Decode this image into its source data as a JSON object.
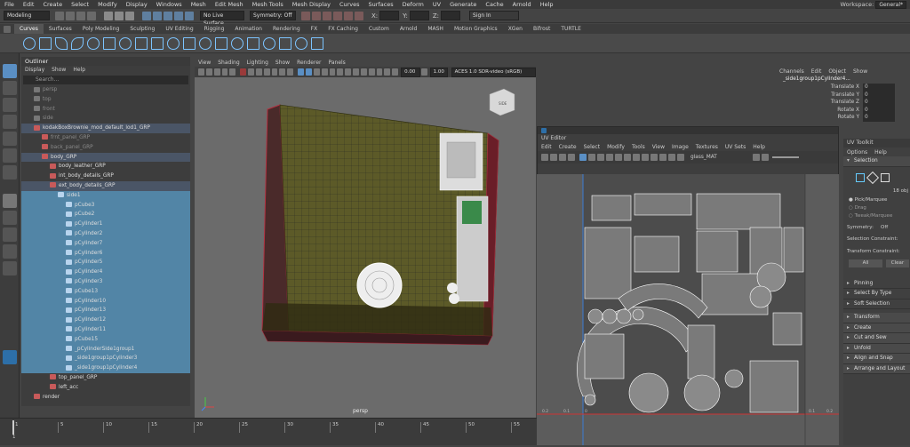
{
  "menubar": {
    "items": [
      "File",
      "Edit",
      "Create",
      "Select",
      "Modify",
      "Display",
      "Windows",
      "Mesh",
      "Edit Mesh",
      "Mesh Tools",
      "Mesh Display",
      "Curves",
      "Surfaces",
      "Deform",
      "UV",
      "Generate",
      "Cache",
      "Arnold",
      "Help"
    ],
    "workspace_label": "Workspace:",
    "workspace_value": "General*"
  },
  "status": {
    "mode": "Modeling",
    "live_surface": "No Live Surface",
    "symmetry": "Symmetry: Off",
    "x_label": "X:",
    "y_label": "Y:",
    "z_label": "Z:",
    "sign_in": "Sign In"
  },
  "shelf_tabs": [
    "Curves",
    "Surfaces",
    "Poly Modeling",
    "Sculpting",
    "UV Editing",
    "Rigging",
    "Animation",
    "Rendering",
    "FX",
    "FX Caching",
    "Custom",
    "Arnold",
    "MASH",
    "Motion Graphics",
    "XGen",
    "Bifrost",
    "TURTLE"
  ],
  "shelf_active": "Curves",
  "outliner": {
    "title": "Outliner",
    "menu": [
      "Display",
      "Show",
      "Help"
    ],
    "search_placeholder": "Search...",
    "items": [
      {
        "label": "persp",
        "indent": 0,
        "state": "dim"
      },
      {
        "label": "top",
        "indent": 0,
        "state": "dim"
      },
      {
        "label": "front",
        "indent": 0,
        "state": "dim"
      },
      {
        "label": "side",
        "indent": 0,
        "state": "dim"
      },
      {
        "label": "kodakBoxBrownie_mod_default_lod1_GRP",
        "indent": 0,
        "state": "hl"
      },
      {
        "label": "frnt_panel_GRP",
        "indent": 1,
        "state": "dim"
      },
      {
        "label": "back_panel_GRP",
        "indent": 1,
        "state": "dim"
      },
      {
        "label": "body_GRP",
        "indent": 1,
        "state": "hl"
      },
      {
        "label": "body_leather_GRP",
        "indent": 2,
        "state": ""
      },
      {
        "label": "int_body_details_GRP",
        "indent": 2,
        "state": ""
      },
      {
        "label": "ext_body_details_GRP",
        "indent": 2,
        "state": "hl"
      },
      {
        "label": "side1",
        "indent": 3,
        "state": "sel"
      },
      {
        "label": "pCube3",
        "indent": 4,
        "state": "sel"
      },
      {
        "label": "pCube2",
        "indent": 4,
        "state": "sel"
      },
      {
        "label": "pCylinder1",
        "indent": 4,
        "state": "sel"
      },
      {
        "label": "pCylinder2",
        "indent": 4,
        "state": "sel"
      },
      {
        "label": "pCylinder7",
        "indent": 4,
        "state": "sel"
      },
      {
        "label": "pCylinder6",
        "indent": 4,
        "state": "sel"
      },
      {
        "label": "pCylinder5",
        "indent": 4,
        "state": "sel"
      },
      {
        "label": "pCylinder4",
        "indent": 4,
        "state": "sel"
      },
      {
        "label": "pCylinder3",
        "indent": 4,
        "state": "sel"
      },
      {
        "label": "pCube13",
        "indent": 4,
        "state": "sel"
      },
      {
        "label": "pCylinder10",
        "indent": 4,
        "state": "sel"
      },
      {
        "label": "pCylinder13",
        "indent": 4,
        "state": "sel"
      },
      {
        "label": "pCylinder12",
        "indent": 4,
        "state": "sel"
      },
      {
        "label": "pCylinder11",
        "indent": 4,
        "state": "sel"
      },
      {
        "label": "pCube15",
        "indent": 4,
        "state": "sel"
      },
      {
        "label": "_pCylinderSide1group1",
        "indent": 4,
        "state": "sel"
      },
      {
        "label": "_side1group1pCylinder3",
        "indent": 4,
        "state": "sel"
      },
      {
        "label": "_side1group1pCylinder4",
        "indent": 4,
        "state": "sel"
      },
      {
        "label": "top_panel_GRP",
        "indent": 2,
        "state": ""
      },
      {
        "label": "left_acc",
        "indent": 2,
        "state": ""
      },
      {
        "label": "render",
        "indent": 0,
        "state": ""
      }
    ]
  },
  "viewport": {
    "menu": [
      "View",
      "Shading",
      "Lighting",
      "Show",
      "Renderer",
      "Panels"
    ],
    "field1": "0.00",
    "field2": "1.00",
    "colorspace": "ACES 1.0 SDR-video (sRGB)",
    "camera_label": "persp",
    "cube_label": "SIDE"
  },
  "channel_box": {
    "menu": [
      "Channels",
      "Edit",
      "Object",
      "Show"
    ],
    "object": "_side1group1pCylinder4...",
    "attrs": [
      {
        "k": "Translate X",
        "v": "0"
      },
      {
        "k": "Translate Y",
        "v": "0"
      },
      {
        "k": "Translate Z",
        "v": "0"
      },
      {
        "k": "Rotate X",
        "v": "0"
      },
      {
        "k": "Rotate Y",
        "v": "0"
      }
    ]
  },
  "uv_editor": {
    "title": "UV Editor",
    "menu": [
      "Edit",
      "Create",
      "Select",
      "Modify",
      "Tools",
      "View",
      "Image",
      "Textures",
      "UV Sets",
      "Help"
    ],
    "material": "glass_MAT",
    "axis_labels": [
      "0.2",
      "0.1",
      "0",
      "0.1",
      "0.2"
    ]
  },
  "uv_toolkit": {
    "title": "UV Toolkit",
    "menu": [
      "Options",
      "Help"
    ],
    "selection_header": "Selection",
    "obj_count": "18 obj",
    "pick_options": [
      "Pick/Marquee",
      "Drag",
      "Tweak/Marquee"
    ],
    "symmetry_label": "Symmetry:",
    "symmetry_value": "Off",
    "selection_constraint": "Selection Constraint:",
    "transform_constraint": "Transform Constraint:",
    "all_btn": "All",
    "clear_btn": "Clear",
    "subsections": [
      "Pinning",
      "Select By Type",
      "Soft Selection"
    ],
    "sections": [
      "Transform",
      "Create",
      "Cut and Sew",
      "Unfold",
      "Align and Snap",
      "Arrange and Layout"
    ]
  },
  "timeline": {
    "ticks": [
      "1",
      "5",
      "10",
      "15",
      "20",
      "25",
      "30",
      "35",
      "40",
      "45",
      "50",
      "55"
    ],
    "current": "1"
  },
  "colors": {
    "accent": "#5285a6",
    "shelf_icon": "#7cc4ff",
    "model_face": "#5c5a28",
    "model_edge": "#7a1a22"
  },
  "icons": [
    "select-tool-icon",
    "lasso-icon",
    "paint-select-icon",
    "move-icon",
    "rotate-icon",
    "scale-icon",
    "show-manipulator-icon",
    "view-cube-icon",
    "maya-logo-icon"
  ]
}
